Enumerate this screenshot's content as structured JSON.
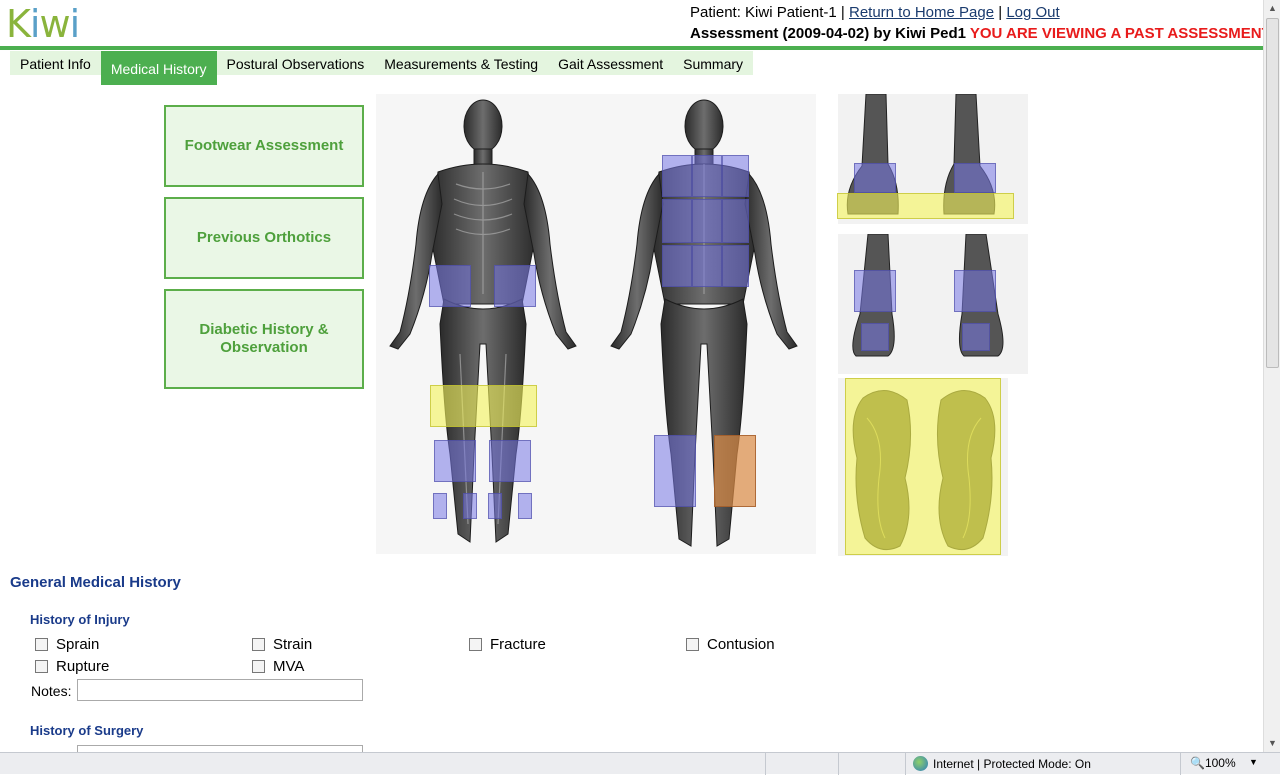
{
  "header": {
    "logo": "Kiwi",
    "patient_label": "Patient: Kiwi Patient-1 |",
    "home_link": "Return to Home Page",
    "separator": "|",
    "logout_link": "Log Out",
    "assessment": "Assessment (2009-04-02) by Kiwi Ped1",
    "warning": "YOU ARE VIEWING A PAST ASSESSMENT"
  },
  "tabs": [
    {
      "label": "Patient Info",
      "active": false
    },
    {
      "label": "Medical History",
      "active": true
    },
    {
      "label": "Postural Observations",
      "active": false
    },
    {
      "label": "Measurements & Testing",
      "active": false
    },
    {
      "label": "Gait Assessment",
      "active": false
    },
    {
      "label": "Summary",
      "active": false
    }
  ],
  "side_buttons": {
    "footwear": "Footwear Assessment",
    "orthotics": "Previous Orthotics",
    "diabetic_1": "Diabetic History &",
    "diabetic_2": "Observation"
  },
  "zone_colors": {
    "selected": "#f5f55a",
    "default": "#7878e6",
    "flagged": "#dc8c46"
  },
  "general": {
    "title": "General Medical History",
    "injury": {
      "title": "History of Injury",
      "items": [
        "Sprain",
        "Strain",
        "Fracture",
        "Contusion",
        "Rupture",
        "MVA"
      ],
      "notes_label": "Notes:",
      "notes_value": ""
    },
    "surgery": {
      "title": "History of Surgery"
    }
  },
  "status": {
    "zone": "Internet | Protected Mode: On",
    "zoom": "100%"
  }
}
